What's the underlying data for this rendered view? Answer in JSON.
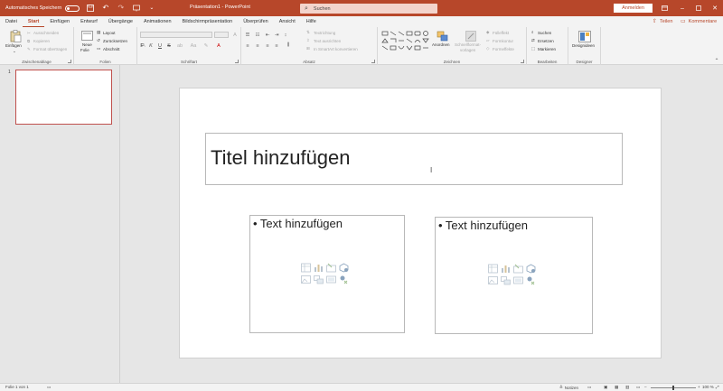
{
  "titlebar": {
    "autosave_label": "Automatisches Speichern",
    "title": "Präsentation1 - PowerPoint",
    "search_placeholder": "Suchen",
    "signin_label": "Anmelden",
    "colors": {
      "accent": "#b7472a"
    }
  },
  "tabs": {
    "items": [
      "Datei",
      "Start",
      "Einfügen",
      "Entwurf",
      "Übergänge",
      "Animationen",
      "Bildschirmpräsentation",
      "Überprüfen",
      "Ansicht",
      "Hilfe"
    ],
    "active": "Start",
    "share_label": "Teilen",
    "comments_label": "Kommentare"
  },
  "ribbon": {
    "clipboard": {
      "label": "Zwischenablage",
      "paste": "Einfügen",
      "cut": "Ausschneiden",
      "copy": "Kopieren",
      "format_painter": "Format übertragen"
    },
    "slides": {
      "label": "Folien",
      "new_slide_line1": "Neue",
      "new_slide_line2": "Folie",
      "layout": "Layout",
      "reset": "Zurücksetzen",
      "section": "Abschnitt"
    },
    "font": {
      "label": "Schriftart"
    },
    "paragraph": {
      "label": "Absatz",
      "text_direction": "Textrichtung",
      "align_text": "Text ausrichten",
      "smartart": "In SmartArt konvertieren"
    },
    "drawing": {
      "label": "Zeichnen",
      "arrange": "Anordnen",
      "quick_styles_line1": "Schnellformat-",
      "quick_styles_line2": "vorlagen",
      "fill": "Fülleffekt",
      "outline": "Formkontur",
      "effects": "Formeffekte"
    },
    "editing": {
      "label": "Bearbeiten",
      "find": "Suchen",
      "replace": "Ersetzen",
      "select": "Markieren"
    },
    "designer": {
      "label": "Designer",
      "button": "Designideen"
    }
  },
  "thumbnails": {
    "slide_number": "1"
  },
  "slide": {
    "title_placeholder": "Titel hinzufügen",
    "left_content_placeholder": "• Text hinzufügen",
    "right_content_placeholder": "• Text hinzufügen"
  },
  "statusbar": {
    "slide_info": "Folie 1 von 1",
    "notes_label": "Notizen",
    "zoom": "100 %"
  }
}
